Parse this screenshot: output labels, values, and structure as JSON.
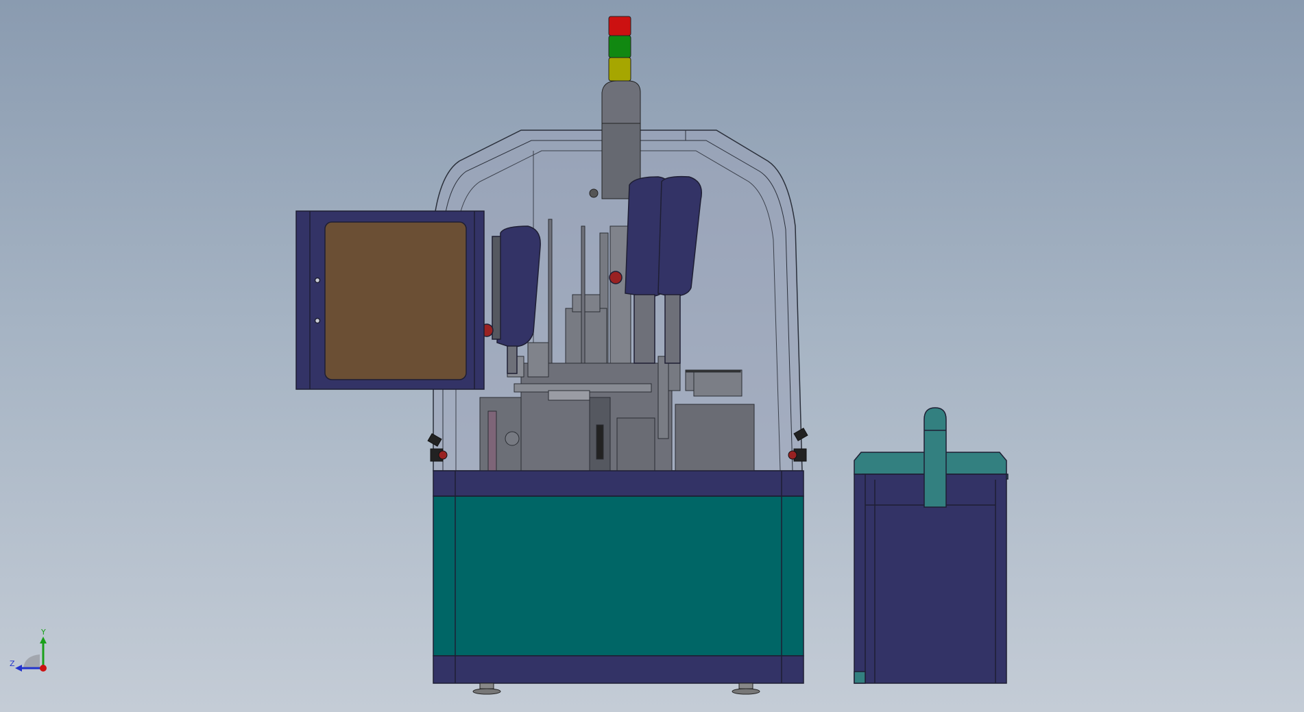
{
  "viewport": {
    "background_top": "#8a9bb0",
    "background_bottom": "#c4ccd6"
  },
  "model": {
    "colors": {
      "frame_navy": "#333366",
      "panel_teal": "#006666",
      "lid_teal": "#338080",
      "window_brown": "#6b4f34",
      "glass": "#9aa3b8",
      "mechanism_gray": "#6e7079",
      "stack_light_red": "#cc1111",
      "stack_light_green": "#118811",
      "stack_light_yellow": "#a6a600"
    },
    "stack_light_segments": [
      "red",
      "green",
      "yellow"
    ]
  },
  "triad": {
    "y_label": "Y",
    "z_label": "Z",
    "y_color": "#1aa01a",
    "z_color": "#2233cc",
    "x_color": "#cc1111"
  }
}
